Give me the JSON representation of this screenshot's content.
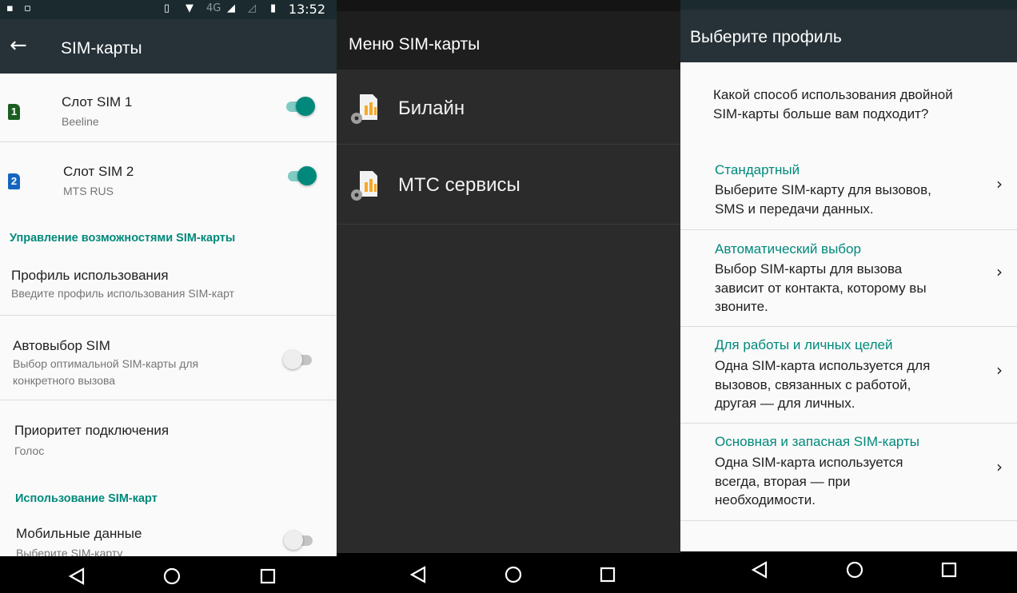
{
  "colors": {
    "accent": "#00897b",
    "appbar": "#263238",
    "dark_bg": "#2b2b2b",
    "sim1_badge": "#1b5e20",
    "sim2_badge": "#1565c0"
  },
  "status_bar": {
    "time": "13:52"
  },
  "panel_sim_cards": {
    "title": "SIM-карты",
    "back_icon": "arrow-left-icon",
    "slot1": {
      "title": "Слот SIM 1",
      "subtitle": "Beeline",
      "badge": "1",
      "enabled": true
    },
    "slot2": {
      "title": "Слот SIM 2",
      "subtitle": "MTS RUS",
      "badge": "2",
      "enabled": true
    },
    "section_manage": "Управление возможностями SIM-карты",
    "usage_profile": {
      "title": "Профиль использования",
      "subtitle": "Введите профиль использования SIM-карт"
    },
    "auto_select": {
      "title": "Автовыбор SIM",
      "subtitle_line1": "Выбор оптимальной SIM-карты для",
      "subtitle_line2": "конкретного вызова",
      "enabled": false
    },
    "connection_priority": {
      "title": "Приоритет подключения",
      "subtitle": "Голос"
    },
    "section_usage": "Использование SIM-карт",
    "mobile_data": {
      "title": "Мобильные данные",
      "subtitle": "Выберите SIM-карту",
      "enabled": false
    }
  },
  "panel_sim_menu": {
    "title": "Меню SIM-карты",
    "items": [
      {
        "label": "Билайн",
        "icon": "sim-settings-icon"
      },
      {
        "label": "МТС сервисы",
        "icon": "sim-settings-icon"
      }
    ]
  },
  "panel_profile": {
    "title": "Выберите профиль",
    "question_line1": "Какой способ использования двойной",
    "question_line2": "SIM-карты больше вам подходит?",
    "options": [
      {
        "title": "Стандартный",
        "desc_lines": [
          "Выберите SIM-карту для вызовов,",
          "SMS и передачи данных."
        ]
      },
      {
        "title": "Автоматический выбор",
        "desc_lines": [
          "Выбор SIM-карты для вызова",
          "зависит от контакта, которому вы",
          "звоните."
        ]
      },
      {
        "title": "Для работы и личных целей",
        "desc_lines": [
          "Одна SIM-карта используется для",
          "вызовов, связанных с работой,",
          "другая — для личных."
        ]
      },
      {
        "title": "Основная и запасная SIM-карты",
        "desc_lines": [
          "Одна SIM-карта используется",
          "всегда, вторая — при",
          "необходимости."
        ]
      }
    ],
    "chevron_icon": "chevron-right-icon"
  },
  "navbar": {
    "back_icon": "nav-back-icon",
    "home_icon": "nav-home-icon",
    "recents_icon": "nav-recents-icon"
  }
}
